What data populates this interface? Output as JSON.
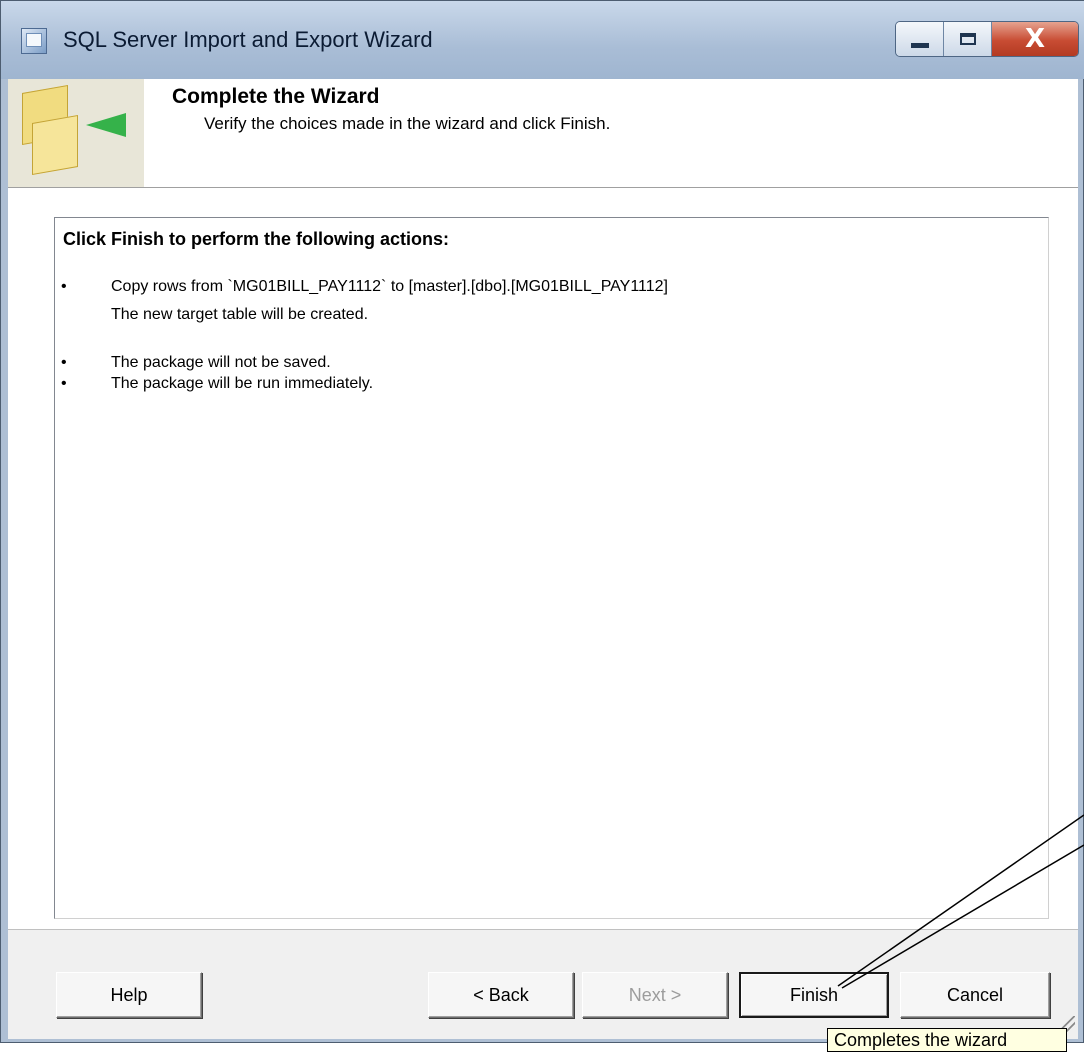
{
  "window": {
    "title": "SQL Server Import and Export Wizard",
    "close_glyph": "X"
  },
  "header": {
    "title": "Complete the Wizard",
    "subtitle": "Verify the choices made in the wizard and click Finish."
  },
  "summary": {
    "heading": "Click Finish to perform the following actions:",
    "bullet": "•",
    "items": [
      "Copy rows from `MG01BILL_PAY1112` to [master].[dbo].[MG01BILL_PAY1112]",
      "The package will not be saved.",
      "The package will be run immediately."
    ],
    "item0_detail": "The new target table will be created."
  },
  "buttons": {
    "help": "Help",
    "back": "< Back",
    "next": "Next >",
    "finish": "Finish",
    "cancel": "Cancel"
  },
  "tooltip": "Completes the wizard",
  "colors": {
    "title_bar": "#a9bdd6",
    "close_button": "#c84c33",
    "tooltip_bg": "#ffffe1"
  }
}
